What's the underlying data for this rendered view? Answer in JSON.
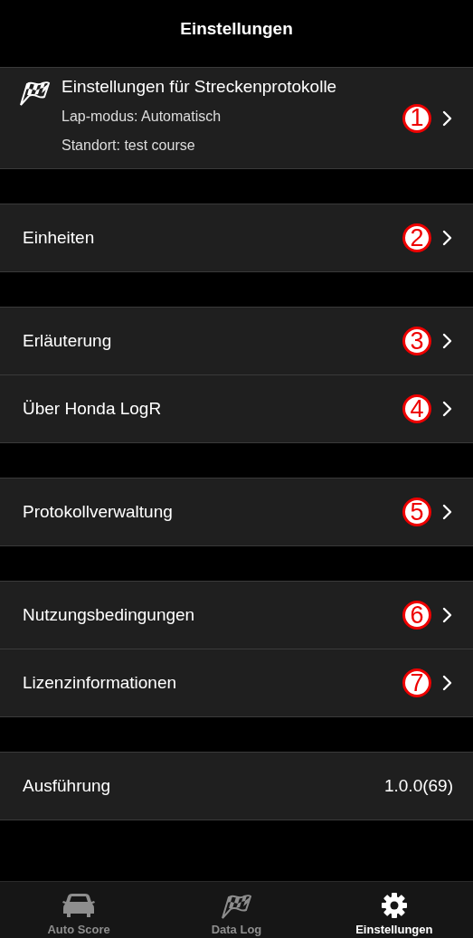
{
  "header": {
    "title": "Einstellungen"
  },
  "groups": [
    {
      "items": [
        {
          "kind": "track",
          "label": "Einstellungen für Streckenprotokolle",
          "details": [
            "Lap-modus: Automatisch",
            "Standort: test course"
          ],
          "badge": "1"
        }
      ]
    },
    {
      "items": [
        {
          "kind": "nav",
          "label": "Einheiten",
          "badge": "2"
        }
      ]
    },
    {
      "items": [
        {
          "kind": "nav",
          "label": "Erläuterung",
          "badge": "3"
        },
        {
          "kind": "nav",
          "label": "Über Honda LogR",
          "badge": "4"
        }
      ]
    },
    {
      "items": [
        {
          "kind": "nav",
          "label": "Protokollverwaltung",
          "badge": "5"
        }
      ]
    },
    {
      "items": [
        {
          "kind": "nav",
          "label": "Nutzungsbedingungen",
          "badge": "6"
        },
        {
          "kind": "nav",
          "label": "Lizenzinformationen",
          "badge": "7"
        }
      ]
    },
    {
      "items": [
        {
          "kind": "value",
          "label": "Ausführung",
          "value": "1.0.0(69)"
        }
      ]
    }
  ],
  "tab_bar": [
    {
      "label": "Auto Score",
      "selected": false
    },
    {
      "label": "Data Log",
      "selected": false
    },
    {
      "label": "Einstellungen",
      "selected": true
    }
  ]
}
